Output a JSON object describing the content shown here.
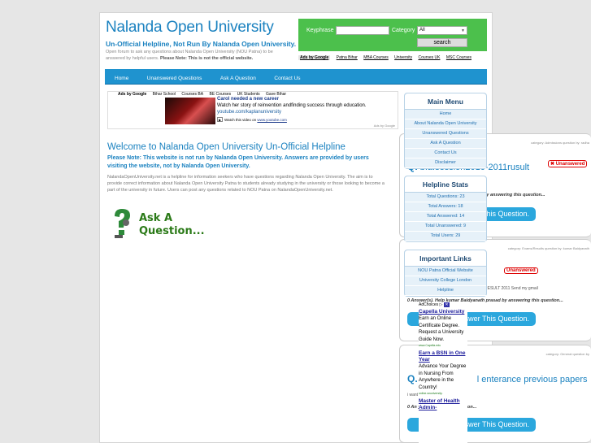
{
  "header": {
    "title": "Nalanda Open University",
    "subtitle": "Un-Official Helpline, Not Run By Nalanda Open University.",
    "description": "Open forum to ask any questions about Nalanda Open University (NOU Patna) to be answered by helpful users.",
    "note": "Please Note: This is not the official website."
  },
  "search": {
    "keyphrase_label": "Keyphrase",
    "keyphrase_value": "",
    "category_label": "Category",
    "category_value": "All",
    "button_label": "search"
  },
  "ad_links": {
    "ads_by": "Ads by Google",
    "links": [
      "Patna Bihar",
      "MBA Courses",
      "University",
      "Courses UK",
      "MSC Courses"
    ]
  },
  "nav": {
    "items": [
      "Home",
      "Unanswered Questions",
      "Ask A Question",
      "Contact Us"
    ]
  },
  "ad_banner": {
    "tabs": [
      "Ads by Google",
      "Bihar School",
      "Courses BA",
      "BE Courses",
      "UK Students",
      "Gave Bihar"
    ],
    "title": "Carol needed a new career",
    "line1": "Watch her story of reinvention andfinding success through education.",
    "url": "youtube.com/kaplanuniversity",
    "video_text": "Watch this video on",
    "video_site": "www.youtube.com",
    "footer": "Ads by Google"
  },
  "welcome": {
    "title": "Welcome to Nalanda Open University Un-Official Helpline",
    "note": "Please Note: This website is not run by Nalanda Open University. Answers are provided by users visiting the website, not by Nalanda Open University.",
    "body": "NalandaOpenUniversity.net is a helpline for information seekers who have questions regarding Nalanda Open University. The aim is to provide correct information about Nalanda Open University Patna to students already studying in the university or those looking to become a part of the university in future. Users can post any questions related to NOU Patna on NalandaOpenUniversity.net.",
    "ask_label_line1": "Ask A",
    "ask_label_line2": "Question..."
  },
  "sidebar": {
    "main_menu": {
      "title": "Main Menu",
      "items": [
        "Home",
        "About Nalanda Open University",
        "Unanswered Questions",
        "Ask A Question",
        "Contact Us",
        "Disclaimer"
      ]
    },
    "stats": {
      "title": "Helpline Stats",
      "items": [
        "Total Questions: 23",
        "Total Answers: 18",
        "Total Answered: 14",
        "Total Unanswered: 9",
        "Total Users: 29"
      ]
    },
    "links": {
      "title": "Important Links",
      "items": [
        "NOU Patna Official Website",
        "University College London",
        "Helpline"
      ]
    }
  },
  "questions": [
    {
      "meta": "category: Admissions  question by: radha",
      "q_prefix": "Q.",
      "title": "b.a.session2010-2011rusult",
      "badge": "✖ Unanswered",
      "body": "",
      "answers": "l by answering this question...",
      "button": "Answer This Question."
    },
    {
      "meta": "category: Exams/Results  question by: kumar Baidyanath",
      "q_prefix": "",
      "title": "",
      "badge": "Unanswered",
      "body": "RESULT 2011 Send my gmail",
      "answers": "0 Answer(s). Help kumar Baidyanath prasad by answering this question...",
      "button": "Answer This Question."
    },
    {
      "meta": "category: General  question by",
      "q_prefix": "Q.",
      "title": "l enterance previous papers",
      "badge": "",
      "body": "i want  ious or old papers",
      "answers": "0 An  y answering this question...",
      "button": "Answer This Question."
    }
  ],
  "adchoices": {
    "label": "AdChoices ▷",
    "ads": [
      {
        "title": "Capella University",
        "desc": "Earn an Online Certificate Degree. Request a University Guide Now.",
        "url": "www.Capella.edu"
      },
      {
        "title": "Earn a BSN in One Year",
        "desc": "Advance Your Degree in Nursing From Anywhere in the Country!",
        "url": "online.snuniversity."
      },
      {
        "title": "Master of Health Admin-",
        "desc": "",
        "url": ""
      }
    ]
  }
}
